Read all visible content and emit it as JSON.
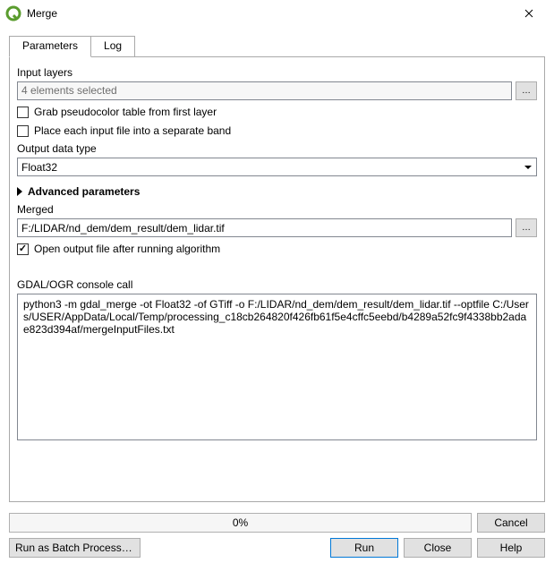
{
  "window": {
    "title": "Merge",
    "close": "✕"
  },
  "tabs": {
    "parameters": "Parameters",
    "log": "Log"
  },
  "params": {
    "input_layers_label": "Input layers",
    "input_layers_value": "4 elements selected",
    "browse_dots": "…",
    "grab_pseudocolor": "Grab pseudocolor table from first layer",
    "separate_band": "Place each input file into a separate band",
    "output_type_label": "Output data type",
    "output_type_value": "Float32",
    "advanced_label": "Advanced parameters",
    "merged_label": "Merged",
    "merged_value": "F:/LIDAR/nd_dem/dem_result/dem_lidar.tif",
    "open_after": "Open output file after running algorithm",
    "console_label": "GDAL/OGR console call",
    "console_text": "python3 -m gdal_merge -ot Float32 -of GTiff -o F:/LIDAR/nd_dem/dem_result/dem_lidar.tif --optfile C:/Users/USER/AppData/Local/Temp/processing_c18cb264820f426fb61f5e4cffc5eebd/b4289a52fc9f4338bb2adae823d394af/mergeInputFiles.txt"
  },
  "progress": {
    "text": "0%"
  },
  "buttons": {
    "cancel": "Cancel",
    "batch": "Run as Batch Process…",
    "run": "Run",
    "close": "Close",
    "help": "Help"
  }
}
